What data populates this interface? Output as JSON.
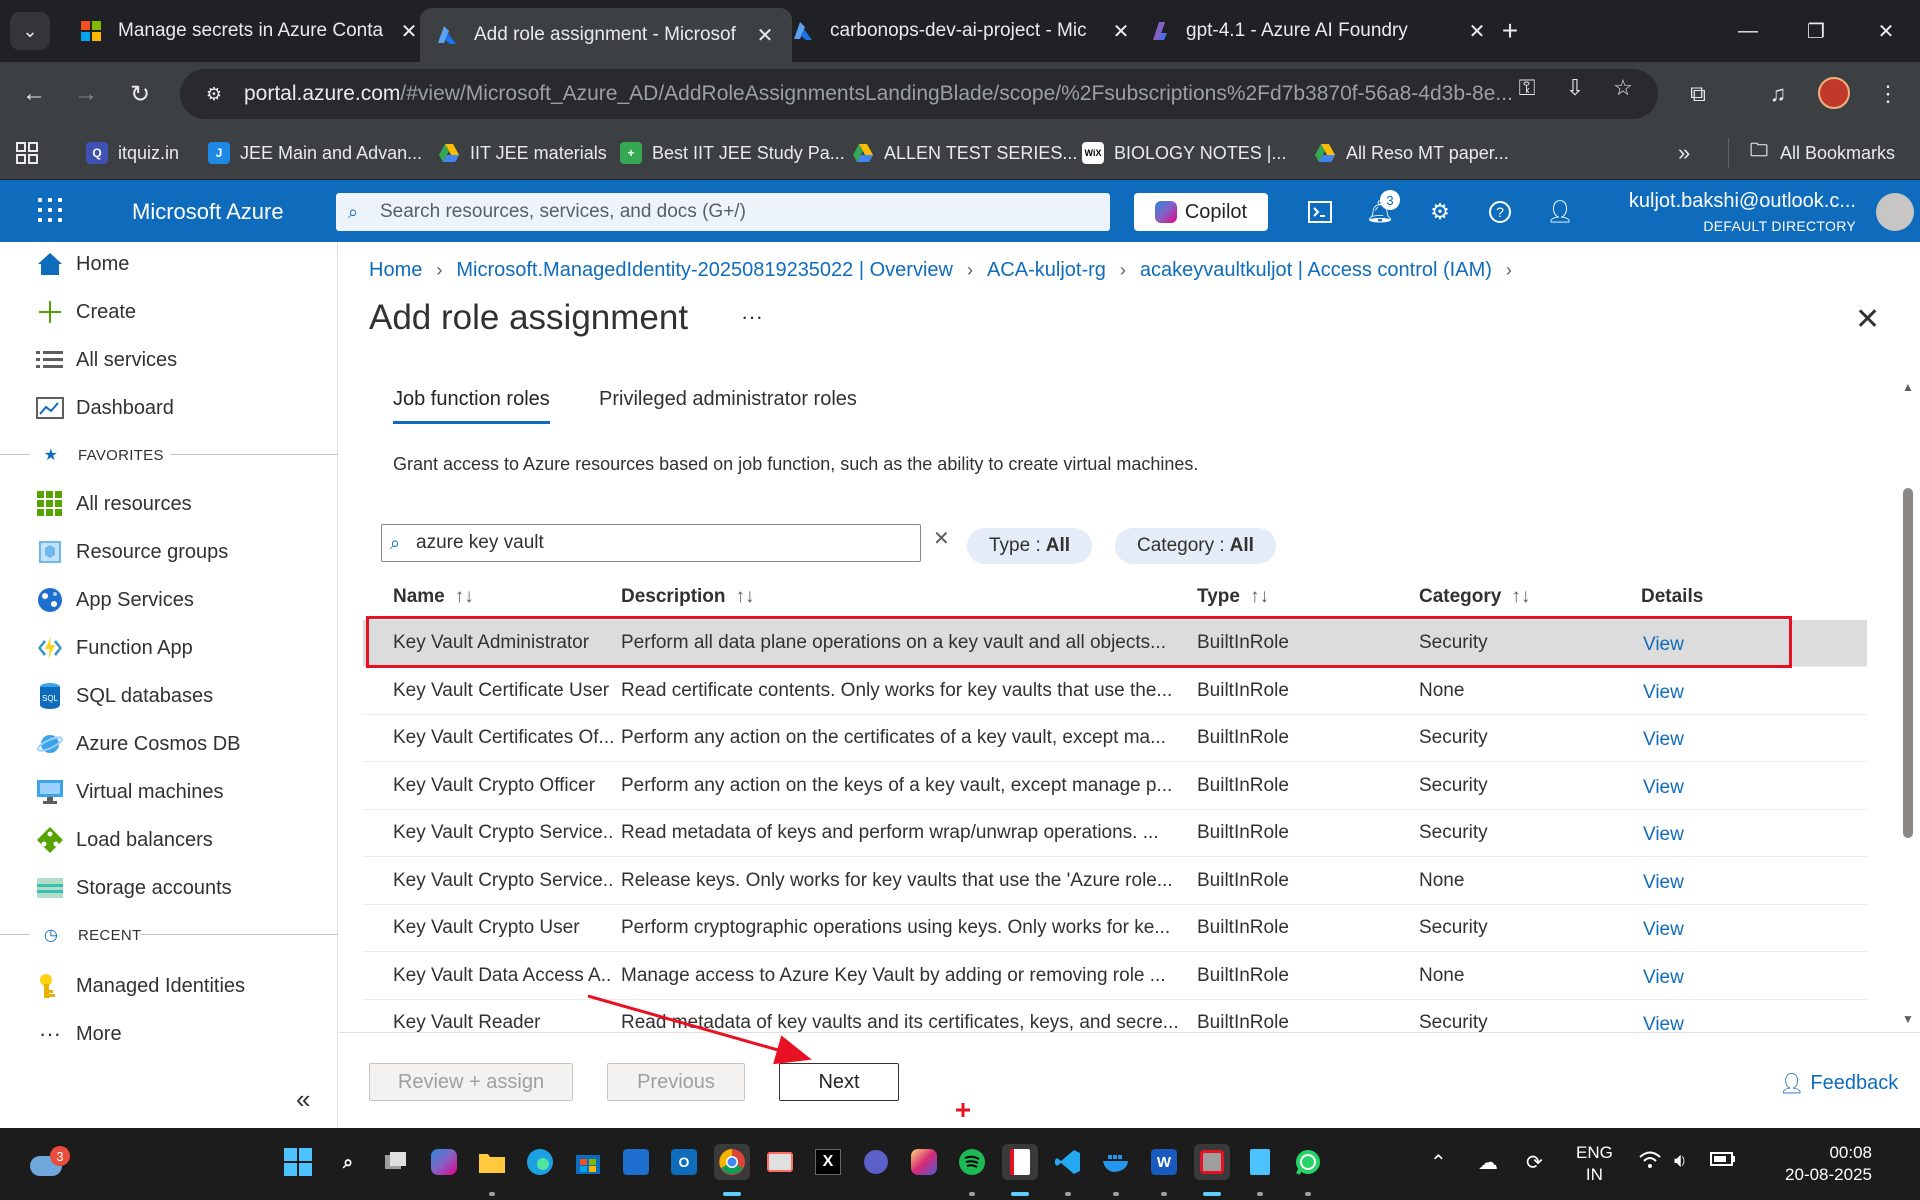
{
  "browser": {
    "tabs": [
      {
        "title": "Manage secrets in Azure Conta",
        "favicon": "microsoft-logo-icon",
        "active": false
      },
      {
        "title": "Add role assignment - Microsof",
        "favicon": "azure-logo-icon",
        "active": true
      },
      {
        "title": "carbonops-dev-ai-project - Mic",
        "favicon": "azure-logo-icon",
        "active": false
      },
      {
        "title": "gpt-4.1 - Azure AI Foundry",
        "favicon": "ai-foundry-icon",
        "active": false
      }
    ],
    "url_host": "portal.azure.com",
    "url_path": "/#view/Microsoft_Azure_AD/AddRoleAssignmentsLandingBlade/scope/%2Fsubscriptions%2Fd7b3870f-56a8-4d3b-8e...",
    "bookmarks": [
      "itquiz.in",
      "JEE Main and Advan...",
      "IIT JEE materials",
      "Best IIT JEE Study Pa...",
      "ALLEN TEST SERIES...",
      "BIOLOGY NOTES |...",
      "All Reso MT paper..."
    ],
    "bookmarks_overflow": "»",
    "all_bookmarks": "All Bookmarks"
  },
  "azure": {
    "brand": "Microsoft Azure",
    "search_placeholder": "Search resources, services, and docs (G+/)",
    "copilot_label": "Copilot",
    "notification_count": "3",
    "account_name": "kuljot.bakshi@outlook.c...",
    "account_directory": "DEFAULT DIRECTORY"
  },
  "sidebar": {
    "items": [
      {
        "label": "Home",
        "icon": "home-icon"
      },
      {
        "label": "Create",
        "icon": "plus-icon"
      },
      {
        "label": "All services",
        "icon": "list-icon"
      },
      {
        "label": "Dashboard",
        "icon": "dashboard-icon"
      }
    ],
    "favorites_label": "FAVORITES",
    "favorites": [
      {
        "label": "All resources",
        "icon": "grid-icon"
      },
      {
        "label": "Resource groups",
        "icon": "cube-icon"
      },
      {
        "label": "App Services",
        "icon": "globe-icon"
      },
      {
        "label": "Function App",
        "icon": "bolt-icon"
      },
      {
        "label": "SQL databases",
        "icon": "database-icon"
      },
      {
        "label": "Azure Cosmos DB",
        "icon": "planet-icon"
      },
      {
        "label": "Virtual machines",
        "icon": "monitor-icon"
      },
      {
        "label": "Load balancers",
        "icon": "diamond-icon"
      },
      {
        "label": "Storage accounts",
        "icon": "storage-icon"
      }
    ],
    "recent_label": "RECENT",
    "recent": [
      {
        "label": "Managed Identities",
        "icon": "key-icon"
      }
    ],
    "more_label": "More"
  },
  "breadcrumb": [
    "Home",
    "Microsoft.ManagedIdentity-20250819235022 | Overview",
    "ACA-kuljot-rg",
    "acakeyvaultkuljot | Access control (IAM)"
  ],
  "page": {
    "title": "Add role assignment",
    "more": "···",
    "tabs": [
      "Job function roles",
      "Privileged administrator roles"
    ],
    "description": "Grant access to Azure resources based on job function, such as the ability to create virtual machines.",
    "search_value": "azure key vault",
    "filters": {
      "type_label": "Type :",
      "type_value": "All",
      "category_label": "Category :",
      "category_value": "All"
    }
  },
  "table": {
    "columns": [
      "Name",
      "Description",
      "Type",
      "Category",
      "Details"
    ],
    "rows": [
      {
        "name": "Key Vault Administrator",
        "description": "Perform all data plane operations on a key vault and all objects...",
        "type": "BuiltInRole",
        "category": "Security",
        "details": "View",
        "selected": true
      },
      {
        "name": "Key Vault Certificate User",
        "description": "Read certificate contents. Only works for key vaults that use the...",
        "type": "BuiltInRole",
        "category": "None",
        "details": "View"
      },
      {
        "name": "Key Vault Certificates Of...",
        "description": "Perform any action on the certificates of a key vault, except ma...",
        "type": "BuiltInRole",
        "category": "Security",
        "details": "View"
      },
      {
        "name": "Key Vault Crypto Officer",
        "description": "Perform any action on the keys of a key vault, except manage p...",
        "type": "BuiltInRole",
        "category": "Security",
        "details": "View"
      },
      {
        "name": "Key Vault Crypto Service...",
        "description": "Read metadata of keys and perform wrap/unwrap operations. ...",
        "type": "BuiltInRole",
        "category": "Security",
        "details": "View"
      },
      {
        "name": "Key Vault Crypto Service...",
        "description": "Release keys. Only works for key vaults that use the 'Azure role...",
        "type": "BuiltInRole",
        "category": "None",
        "details": "View"
      },
      {
        "name": "Key Vault Crypto User",
        "description": "Perform cryptographic operations using keys. Only works for ke...",
        "type": "BuiltInRole",
        "category": "Security",
        "details": "View"
      },
      {
        "name": "Key Vault Data Access A...",
        "description": "Manage access to Azure Key Vault by adding or removing role ...",
        "type": "BuiltInRole",
        "category": "None",
        "details": "View"
      },
      {
        "name": "Key Vault Reader",
        "description": "Read metadata of key vaults and its certificates, keys, and secre...",
        "type": "BuiltInRole",
        "category": "Security",
        "details": "View"
      }
    ]
  },
  "footer": {
    "review_assign": "Review + assign",
    "previous": "Previous",
    "next": "Next",
    "feedback": "Feedback"
  },
  "taskbar": {
    "weather_badge": "3",
    "lang_line1": "ENG",
    "lang_line2": "IN",
    "time": "00:08",
    "date": "20-08-2025"
  },
  "colors": {
    "azure_blue": "#0f6cbd",
    "highlight_red": "#e81123",
    "selected_row": "#dcdcdc"
  }
}
